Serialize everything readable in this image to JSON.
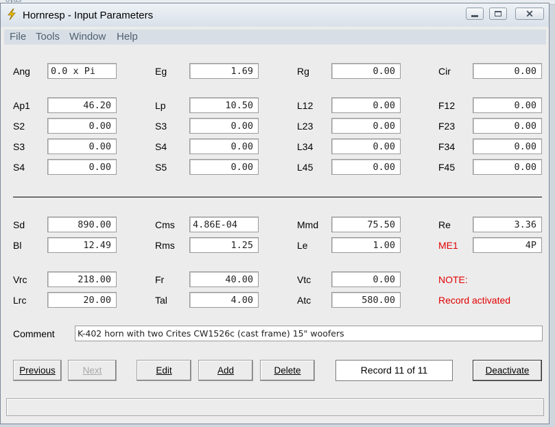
{
  "background": {
    "hint_text": "oyas"
  },
  "window": {
    "title": "Hornresp - Input Parameters",
    "controls": {
      "minimize": "minimize",
      "maximize": "maximize",
      "close": "close"
    }
  },
  "menu": [
    "File",
    "Tools",
    "Window",
    "Help"
  ],
  "params_top": {
    "Ang": {
      "label": "Ang",
      "value": "0.0 x Pi"
    },
    "Eg": {
      "label": "Eg",
      "value": "1.69"
    },
    "Rg": {
      "label": "Rg",
      "value": "0.00"
    },
    "Cir": {
      "label": "Cir",
      "value": "0.00"
    }
  },
  "horn": [
    [
      {
        "label": "Ap1",
        "value": "46.20"
      },
      {
        "label": "Lp",
        "value": "10.50"
      },
      {
        "label": "L12",
        "value": "0.00"
      },
      {
        "label": "F12",
        "value": "0.00"
      }
    ],
    [
      {
        "label": "S2",
        "value": "0.00"
      },
      {
        "label": "S3",
        "value": "0.00"
      },
      {
        "label": "L23",
        "value": "0.00"
      },
      {
        "label": "F23",
        "value": "0.00"
      }
    ],
    [
      {
        "label": "S3",
        "value": "0.00"
      },
      {
        "label": "S4",
        "value": "0.00"
      },
      {
        "label": "L34",
        "value": "0.00"
      },
      {
        "label": "F34",
        "value": "0.00"
      }
    ],
    [
      {
        "label": "S4",
        "value": "0.00"
      },
      {
        "label": "S5",
        "value": "0.00"
      },
      {
        "label": "L45",
        "value": "0.00"
      },
      {
        "label": "F45",
        "value": "0.00"
      }
    ]
  ],
  "driver": [
    [
      {
        "label": "Sd",
        "value": "890.00"
      },
      {
        "label": "Cms",
        "value": "4.86E-04"
      },
      {
        "label": "Mmd",
        "value": "75.50"
      },
      {
        "label": "Re",
        "value": "3.36"
      }
    ],
    [
      {
        "label": "Bl",
        "value": "12.49"
      },
      {
        "label": "Rms",
        "value": "1.25"
      },
      {
        "label": "Le",
        "value": "1.00"
      },
      {
        "label": "ME1",
        "value": "4P"
      }
    ]
  ],
  "chamber": [
    [
      {
        "label": "Vrc",
        "value": "218.00"
      },
      {
        "label": "Fr",
        "value": "40.00"
      },
      {
        "label": "Vtc",
        "value": "0.00"
      }
    ],
    [
      {
        "label": "Lrc",
        "value": "20.00"
      },
      {
        "label": "Tal",
        "value": "4.00"
      },
      {
        "label": "Atc",
        "value": "580.00"
      }
    ]
  ],
  "note": {
    "title": "NOTE:",
    "text": "Record activated",
    "color": "#e00000"
  },
  "comment": {
    "label": "Comment",
    "value": "K-402 horn with two Crites CW1526c (cast frame) 15\" woofers"
  },
  "buttons": {
    "previous": "Previous",
    "next": "Next",
    "edit": "Edit",
    "add": "Add",
    "delete": "Delete",
    "deactivate": "Deactivate"
  },
  "record_status": "Record 11 of 11"
}
